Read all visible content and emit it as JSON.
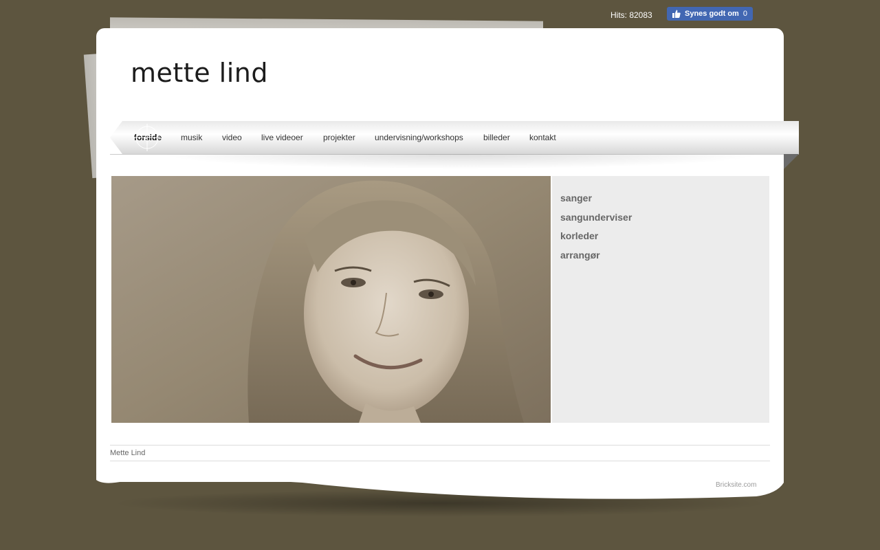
{
  "topbar": {
    "hits_label": "Hits: 82083",
    "fb_like_label": "Synes godt om",
    "fb_like_count": "0"
  },
  "header": {
    "site_title": "mette lind"
  },
  "nav": {
    "items": [
      {
        "label": "forside",
        "active": true
      },
      {
        "label": "musik",
        "active": false
      },
      {
        "label": "video",
        "active": false
      },
      {
        "label": "live videoer",
        "active": false
      },
      {
        "label": "projekter",
        "active": false
      },
      {
        "label": "undervisning/workshops",
        "active": false
      },
      {
        "label": "billeder",
        "active": false
      },
      {
        "label": "kontakt",
        "active": false
      }
    ]
  },
  "main": {
    "roles": [
      "sanger",
      "sangunderviser",
      "korleder",
      "arrangør"
    ]
  },
  "footer": {
    "name": "Mette Lind",
    "credit": "Bricksite.com"
  },
  "colors": {
    "background": "#5d553f",
    "panel": "#ececec",
    "fb_blue": "#4267b2"
  }
}
